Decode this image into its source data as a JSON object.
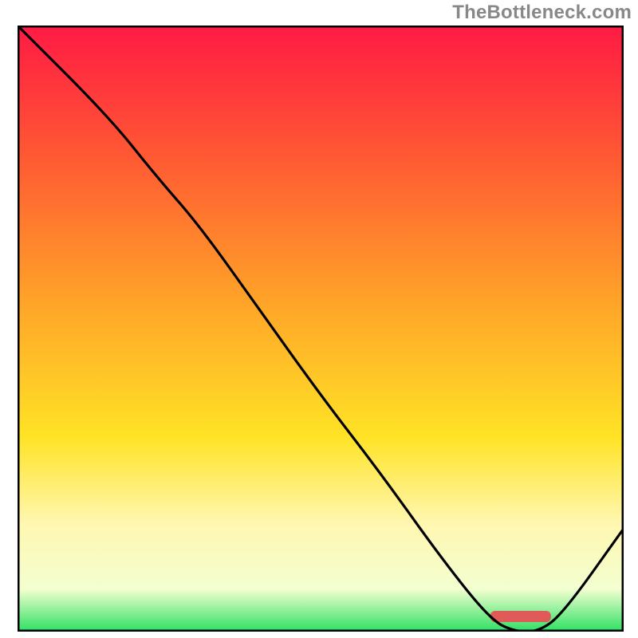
{
  "attribution": "TheBottleneck.com",
  "chart_data": {
    "type": "line",
    "title": "",
    "xlabel": "",
    "ylabel": "",
    "xlim": [
      0,
      100
    ],
    "ylim": [
      0,
      100
    ],
    "x": [
      0,
      15,
      23,
      30,
      40,
      50,
      60,
      70,
      78,
      82,
      86,
      90,
      100
    ],
    "values": [
      100,
      85,
      75,
      67,
      53,
      39,
      26,
      12,
      2,
      0,
      0,
      3,
      17
    ],
    "optimum_band": {
      "start": 78,
      "end": 88
    },
    "gradient_stops": [
      {
        "pct": 0,
        "color": "#ff1a44"
      },
      {
        "pct": 22,
        "color": "#ff5a33"
      },
      {
        "pct": 46,
        "color": "#ffa528"
      },
      {
        "pct": 68,
        "color": "#ffe326"
      },
      {
        "pct": 82,
        "color": "#fff7b0"
      },
      {
        "pct": 93,
        "color": "#f3ffd0"
      },
      {
        "pct": 100,
        "color": "#2de063"
      }
    ]
  }
}
